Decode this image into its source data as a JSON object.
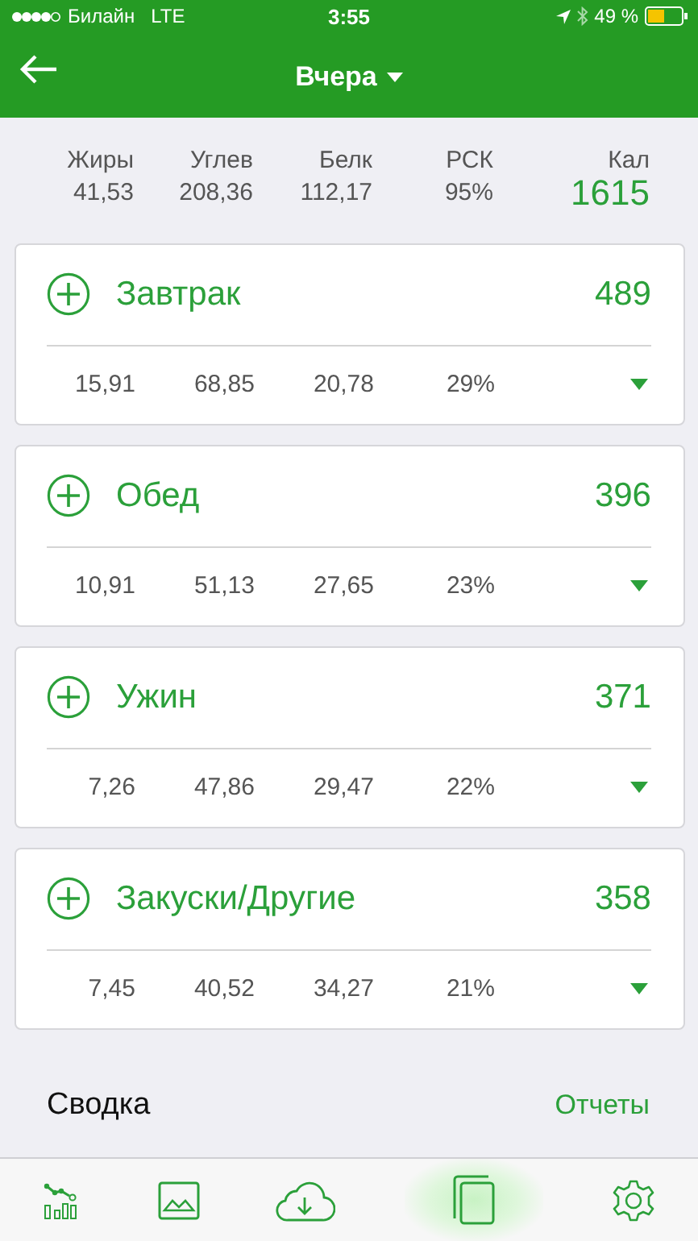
{
  "status_bar": {
    "carrier": "Билайн",
    "network": "LTE",
    "time": "3:55",
    "battery": "49 %"
  },
  "header": {
    "title": "Вчера"
  },
  "totals": {
    "columns": [
      {
        "label": "Жиры",
        "value": "41,53"
      },
      {
        "label": "Углев",
        "value": "208,36"
      },
      {
        "label": "Белк",
        "value": "112,17"
      },
      {
        "label": "РСК",
        "value": "95%"
      },
      {
        "label": "Кал",
        "value": "1615"
      }
    ]
  },
  "meals": [
    {
      "name": "Завтрак",
      "calories": "489",
      "values": [
        "15,91",
        "68,85",
        "20,78",
        "29%"
      ]
    },
    {
      "name": "Обед",
      "calories": "396",
      "values": [
        "10,91",
        "51,13",
        "27,65",
        "23%"
      ]
    },
    {
      "name": "Ужин",
      "calories": "371",
      "values": [
        "7,26",
        "47,86",
        "29,47",
        "22%"
      ]
    },
    {
      "name": "Закуски/Другие",
      "calories": "358",
      "values": [
        "7,45",
        "40,52",
        "34,27",
        "21%"
      ]
    }
  ],
  "summary": {
    "title": "Сводка",
    "link": "Отчеты"
  },
  "tab_bar": [
    {
      "kind": "chart",
      "selected": false
    },
    {
      "kind": "image",
      "selected": false
    },
    {
      "kind": "cloud",
      "selected": false
    },
    {
      "kind": "copy",
      "selected": true
    },
    {
      "kind": "gear",
      "selected": false
    }
  ]
}
